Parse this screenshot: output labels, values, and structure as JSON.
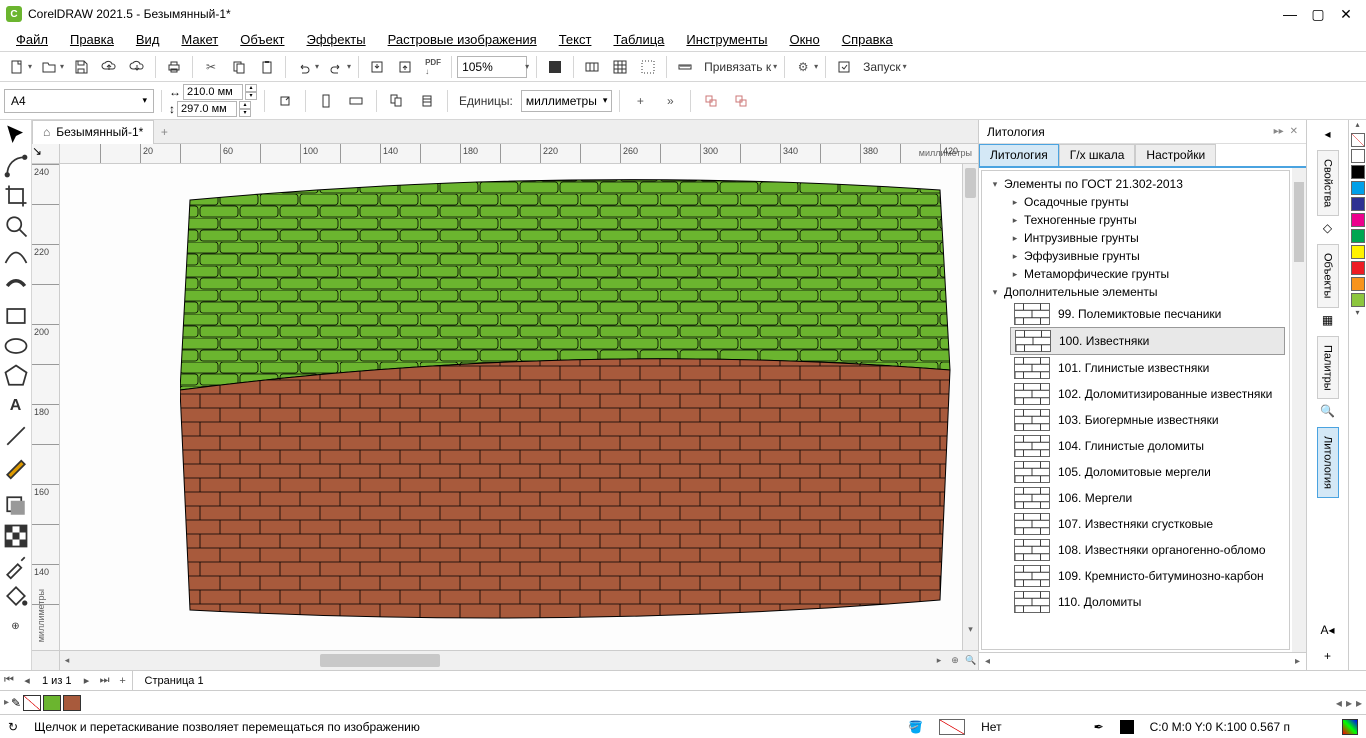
{
  "app": {
    "title": "CorelDRAW 2021.5 - Безымянный-1*"
  },
  "menu": {
    "file": "Файл",
    "edit": "Правка",
    "view": "Вид",
    "layout": "Макет",
    "object": "Объект",
    "effects": "Эффекты",
    "bitmaps": "Растровые изображения",
    "text": "Текст",
    "table": "Таблица",
    "tools": "Инструменты",
    "window": "Окно",
    "help": "Справка"
  },
  "toolbar": {
    "zoom": "105%",
    "snap_label": "Привязать к",
    "launch_label": "Запуск"
  },
  "propbar": {
    "page_size": "A4",
    "width": "210.0 мм",
    "height": "297.0 мм",
    "units_label": "Единицы:",
    "units": "миллиметры"
  },
  "document": {
    "tab": "Безымянный-1*",
    "page_nav": "1 из 1",
    "page_tab": "Страница 1",
    "ruler_unit": "миллиметры"
  },
  "panel": {
    "title": "Литология",
    "tabs": {
      "lithology": "Литология",
      "gx": "Г/х шкала",
      "settings": "Настройки"
    },
    "tree": {
      "root": "Элементы по ГОСТ 21.302-2013",
      "sedimentary": "Осадочные грунты",
      "technogenic": "Техногенные грунты",
      "intrusive": "Интрузивные грунты",
      "effusive": "Эффузивные грунты",
      "metamorphic": "Метаморфические грунты",
      "additional": "Дополнительные элементы"
    },
    "items": [
      {
        "num": "99.",
        "name": "Полемиктовые песчаники"
      },
      {
        "num": "100.",
        "name": "Известняки"
      },
      {
        "num": "101.",
        "name": "Глинистые известняки"
      },
      {
        "num": "102.",
        "name": "Доломитизированные известняки"
      },
      {
        "num": "103.",
        "name": "Биогермные известняки"
      },
      {
        "num": "104.",
        "name": "Глинистые доломиты"
      },
      {
        "num": "105.",
        "name": "Доломитовые мергели"
      },
      {
        "num": "106.",
        "name": "Мергели"
      },
      {
        "num": "107.",
        "name": "Известняки сгустковые"
      },
      {
        "num": "108.",
        "name": "Известняки органогенно-обломо"
      },
      {
        "num": "109.",
        "name": "Кремнисто-битуминозно-карбон"
      },
      {
        "num": "110.",
        "name": "Доломиты"
      }
    ]
  },
  "dock": {
    "properties": "Свойства",
    "objects": "Объекты",
    "palettes": "Палитры",
    "lithology": "Литология"
  },
  "status": {
    "hint": "Щелчок и перетаскивание позволяет перемещаться по изображению",
    "fill_label": "Нет",
    "outline": "C:0 M:0 Y:0 K:100  0.567 п"
  },
  "palette_colors": [
    "#ffffff",
    "#000000",
    "#00a0e8",
    "#2e3192",
    "#ec008c",
    "#00a651",
    "#fff200",
    "#ed1c24",
    "#f7941d",
    "#8dc63f"
  ],
  "canvas_colors": {
    "green": "#6bb52f",
    "brown": "#a85a3c"
  },
  "ruler_h": [
    20,
    60,
    100,
    140,
    180,
    220,
    260,
    300,
    340,
    380,
    420,
    460,
    500,
    540,
    580,
    620,
    660,
    700,
    740,
    780,
    820,
    860,
    900
  ],
  "ruler_h_labels": [
    "",
    "20",
    "",
    "60",
    "",
    "100",
    "",
    "140",
    "",
    "180",
    "",
    "220",
    "",
    "260",
    "",
    "300",
    "",
    "340",
    "",
    "380",
    "",
    "420",
    ""
  ]
}
